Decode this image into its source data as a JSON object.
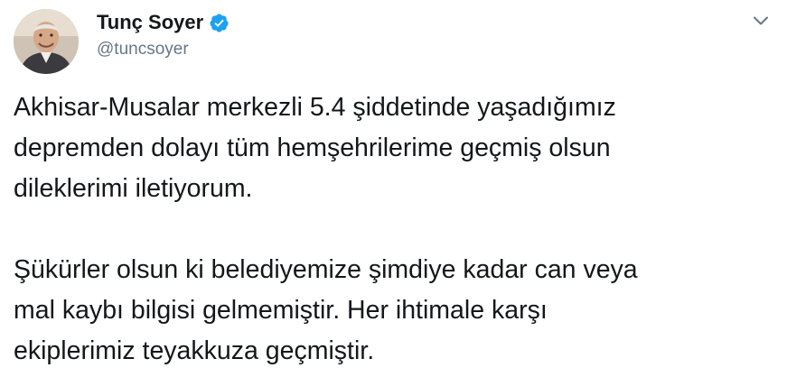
{
  "user": {
    "display_name": "Tunç Soyer",
    "handle": "@tuncsoyer",
    "verified": true,
    "avatar_icon": "profile-photo"
  },
  "menu": {
    "icon": "chevron-down-icon"
  },
  "tweet": {
    "paragraph1": [
      "Akhisar-Musalar merkezli 5.4 şiddetinde yaşadığımız",
      "depremden dolayı tüm hemşehrilerime geçmiş olsun",
      "dileklerimi iletiyorum."
    ],
    "paragraph2": [
      "Şükürler olsun ki belediyemize şimdiye kadar can veya",
      "mal kaybı bilgisi gelmemiştir. Her ihtimale karşı",
      "ekiplerimiz teyakkuza geçmiştir."
    ]
  },
  "colors": {
    "text": "#14171a",
    "secondary_text": "#657786",
    "verified_badge": "#1da1f2",
    "caret": "#657786"
  }
}
